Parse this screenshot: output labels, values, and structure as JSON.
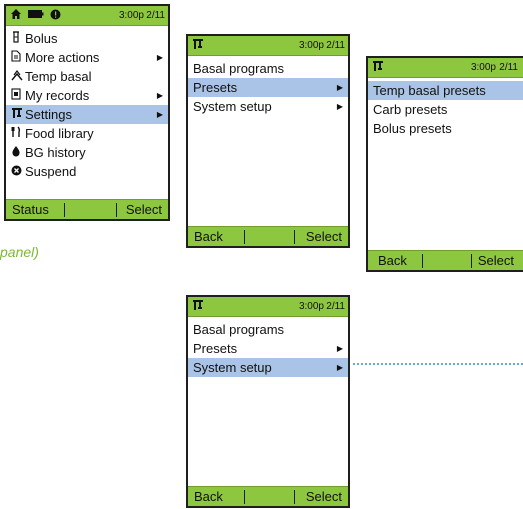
{
  "status": {
    "time": "3:00p",
    "date": "2/11"
  },
  "screen1": {
    "items": [
      {
        "label": "Bolus",
        "icon": "vial-icon",
        "arrow": false,
        "selected": false
      },
      {
        "label": "More actions",
        "icon": "document-icon",
        "arrow": true,
        "selected": false
      },
      {
        "label": "Temp basal",
        "icon": "temp-basal-icon",
        "arrow": false,
        "selected": false
      },
      {
        "label": "My records",
        "icon": "records-icon",
        "arrow": true,
        "selected": false
      },
      {
        "label": "Settings",
        "icon": "settings-icon",
        "arrow": true,
        "selected": true
      },
      {
        "label": "Food library",
        "icon": "fork-knife-icon",
        "arrow": false,
        "selected": false
      },
      {
        "label": "BG history",
        "icon": "drop-icon",
        "arrow": false,
        "selected": false
      },
      {
        "label": "Suspend",
        "icon": "suspend-icon",
        "arrow": false,
        "selected": false
      }
    ],
    "soft_left": "Status",
    "soft_right": "Select"
  },
  "screen2": {
    "items": [
      {
        "label": "Basal programs",
        "arrow": false,
        "selected": false
      },
      {
        "label": "Presets",
        "arrow": true,
        "selected": true
      },
      {
        "label": "System setup",
        "arrow": true,
        "selected": false
      }
    ],
    "soft_left": "Back",
    "soft_right": "Select"
  },
  "screen3": {
    "items": [
      {
        "label": "Temp basal presets",
        "arrow": false,
        "selected": true
      },
      {
        "label": "Carb presets",
        "arrow": false,
        "selected": false
      },
      {
        "label": "Bolus presets",
        "arrow": false,
        "selected": false
      }
    ],
    "soft_left": "Back",
    "soft_right": "Select"
  },
  "screen4": {
    "items": [
      {
        "label": "Basal programs",
        "arrow": false,
        "selected": false
      },
      {
        "label": "Presets",
        "arrow": true,
        "selected": false
      },
      {
        "label": "System setup",
        "arrow": true,
        "selected": true
      }
    ],
    "soft_left": "Back",
    "soft_right": "Select"
  },
  "caption": "panel)",
  "colors": {
    "topbar": "#8dc63f",
    "selection": "#a9c4e6",
    "caption": "#7ab83a",
    "connector": "#6aa9d6"
  }
}
